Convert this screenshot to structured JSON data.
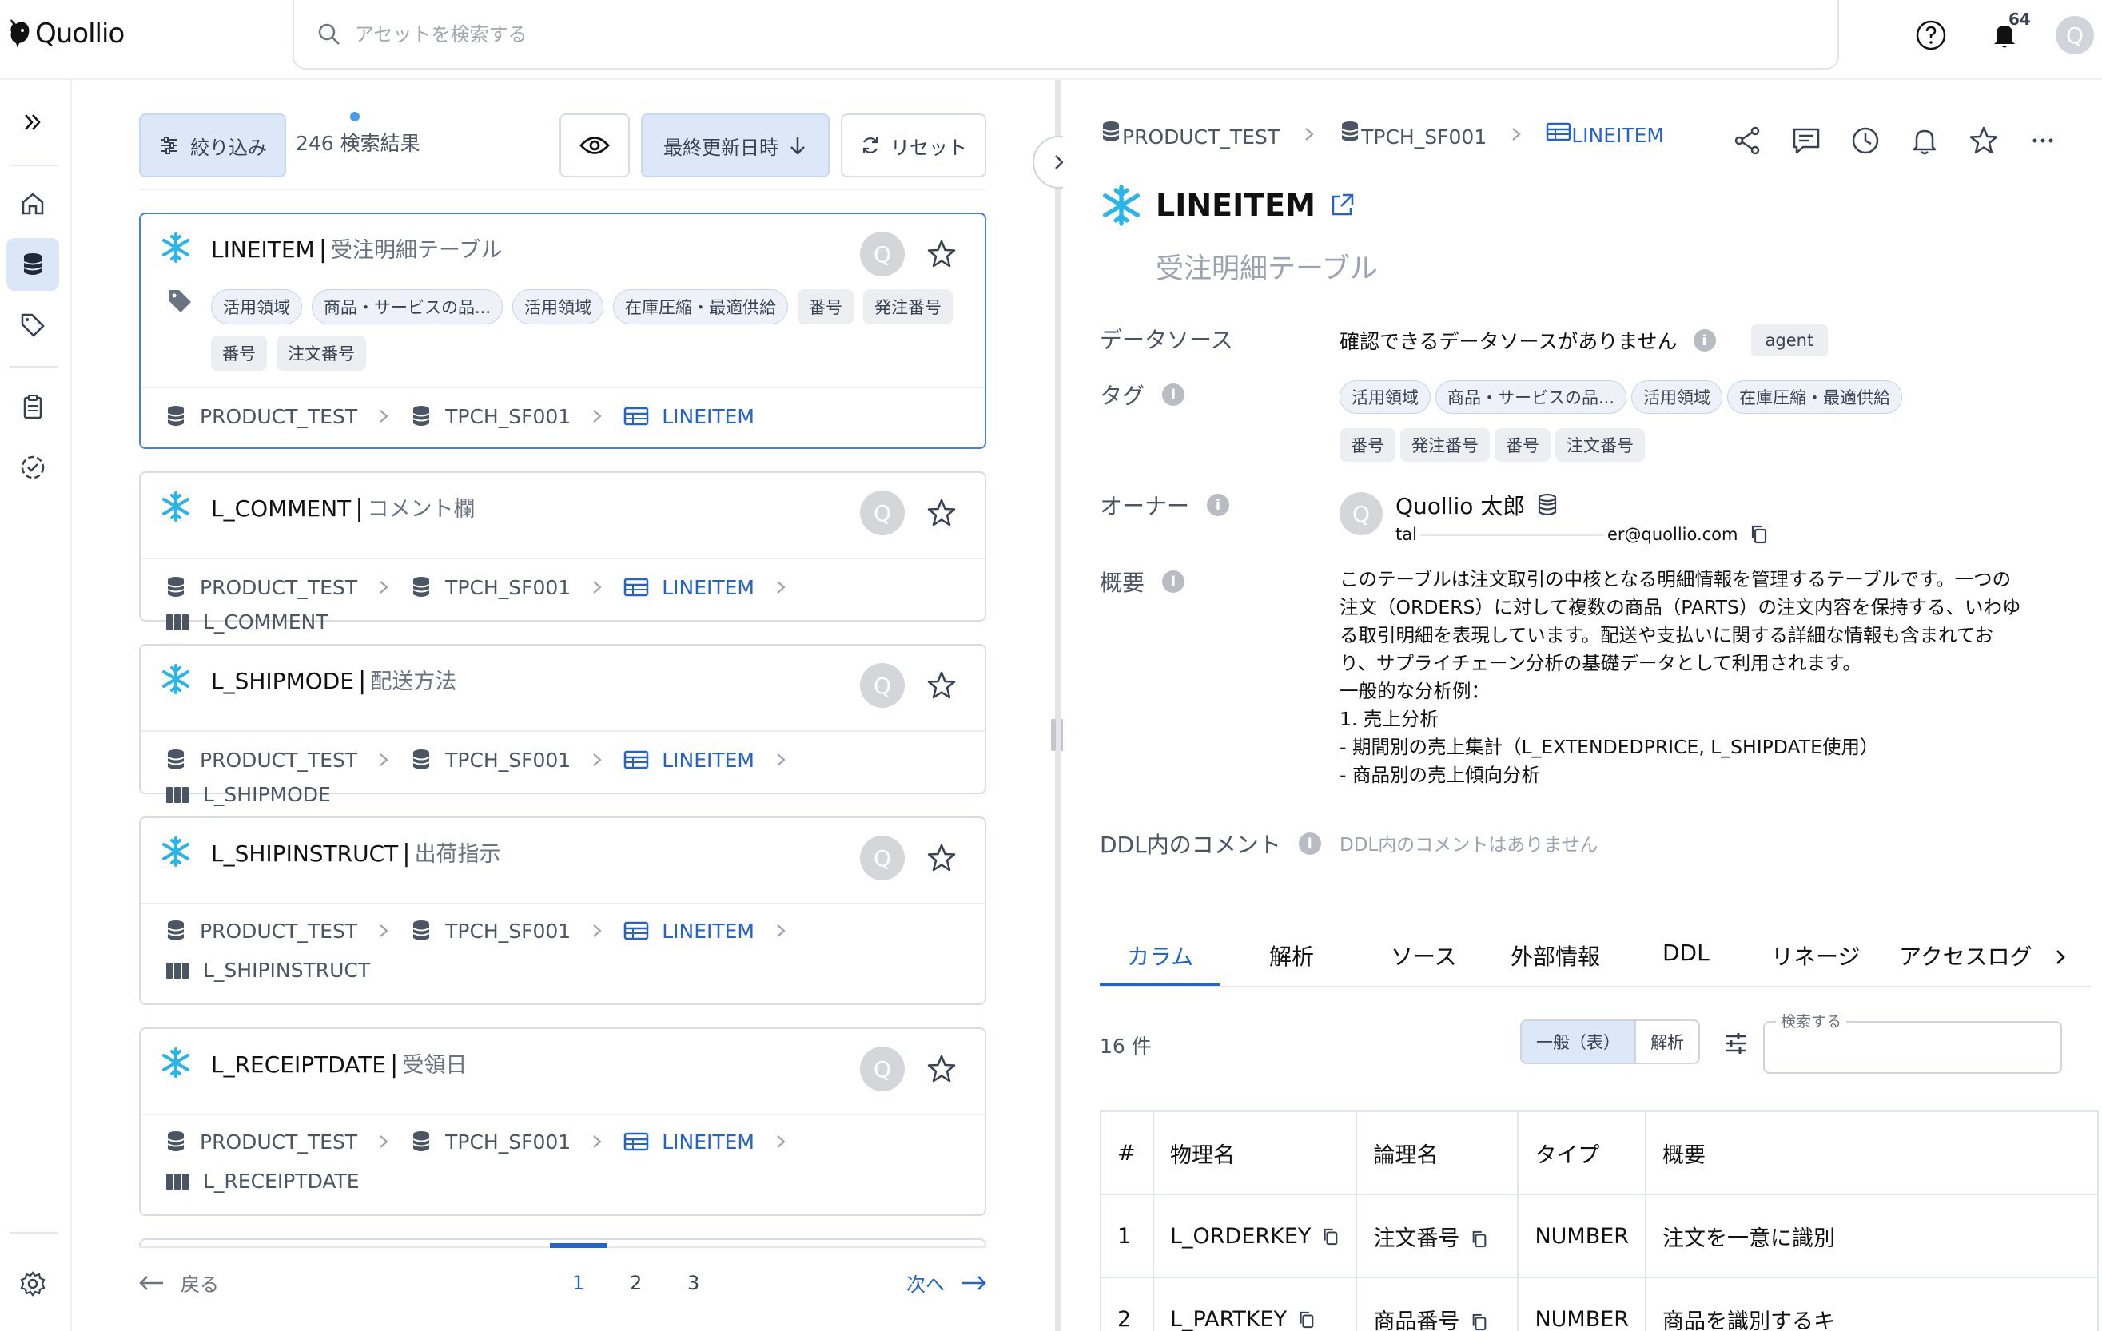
{
  "app": {
    "name": "Quollio"
  },
  "search": {
    "placeholder": "アセットを検索する"
  },
  "header": {
    "notification_count": "64",
    "user_initial": "Q"
  },
  "filters": {
    "filter_label": "絞り込み",
    "result_count": "246 検索結果",
    "sort_label": "最終更新日時",
    "reset_label": "リセット"
  },
  "results": [
    {
      "name": "LINEITEM",
      "logical": "受注明細テーブル",
      "avatar": "Q",
      "tags": [
        {
          "label": "活用領域",
          "style": "outline"
        },
        {
          "label": "商品・サービスの品...",
          "style": "outline"
        },
        {
          "label": "活用領域",
          "style": "outline"
        },
        {
          "label": "在庫圧縮・最適供給",
          "style": "outline"
        },
        {
          "label": "番号",
          "style": "plain"
        },
        {
          "label": "発注番号",
          "style": "plain"
        },
        {
          "label": "番号",
          "style": "plain"
        },
        {
          "label": "注文番号",
          "style": "plain"
        }
      ],
      "path": [
        "PRODUCT_TEST",
        "TPCH_SF001",
        "LINEITEM"
      ]
    },
    {
      "name": "L_COMMENT",
      "logical": "コメント欄",
      "avatar": "Q",
      "path": [
        "PRODUCT_TEST",
        "TPCH_SF001",
        "LINEITEM",
        "L_COMMENT"
      ]
    },
    {
      "name": "L_SHIPMODE",
      "logical": "配送方法",
      "avatar": "Q",
      "path": [
        "PRODUCT_TEST",
        "TPCH_SF001",
        "LINEITEM",
        "L_SHIPMODE"
      ]
    },
    {
      "name": "L_SHIPINSTRUCT",
      "logical": "出荷指示",
      "avatar": "Q",
      "path": [
        "PRODUCT_TEST",
        "TPCH_SF001",
        "LINEITEM",
        "L_SHIPINSTRUCT"
      ]
    },
    {
      "name": "L_RECEIPTDATE",
      "logical": "受領日",
      "avatar": "Q",
      "path": [
        "PRODUCT_TEST",
        "TPCH_SF001",
        "LINEITEM",
        "L_RECEIPTDATE"
      ]
    }
  ],
  "pagination": {
    "prev": "戻る",
    "next": "次へ",
    "pages": [
      "1",
      "2",
      "3"
    ],
    "current": "1"
  },
  "detail": {
    "breadcrumb": [
      "PRODUCT_TEST",
      "TPCH_SF001",
      "LINEITEM"
    ],
    "title": "LINEITEM",
    "subtitle": "受注明細テーブル",
    "fields": {
      "datasource_label": "データソース",
      "datasource_value": "確認できるデータソースがありません",
      "datasource_badge": "agent",
      "tag_label": "タグ",
      "owner_label": "オーナー",
      "summary_label": "概要",
      "ddl_label": "DDL内のコメント",
      "ddl_value": "DDL内のコメントはありません"
    },
    "tags": [
      {
        "label": "活用領域",
        "style": "outline"
      },
      {
        "label": "商品・サービスの品...",
        "style": "outline"
      },
      {
        "label": "活用領域",
        "style": "outline"
      },
      {
        "label": "在庫圧縮・最適供給",
        "style": "outline"
      },
      {
        "label": "番号",
        "style": "plain"
      },
      {
        "label": "発注番号",
        "style": "plain"
      },
      {
        "label": "番号",
        "style": "plain"
      },
      {
        "label": "注文番号",
        "style": "plain"
      }
    ],
    "owner": {
      "initial": "Q",
      "name": "Quollio 太郎",
      "email_start": "tal",
      "email_end": "er@quollio.com"
    },
    "summary": "このテーブルは注文取引の中核となる明細情報を管理するテーブルです。一つの注文（ORDERS）に対して複数の商品（PARTS）の注文内容を保持する、いわゆる取引明細を表現しています。配送や支払いに関する詳細な情報も含まれており、サプライチェーン分析の基礎データとして利用されます。\n一般的な分析例：\n1. 売上分析\n- 期間別の売上集計（L_EXTENDEDPRICE, L_SHIPDATE使用）\n- 商品別の売上傾向分析",
    "tabs": [
      "カラム",
      "解析",
      "ソース",
      "外部情報",
      "DDL",
      "リネージ",
      "アクセスログ"
    ],
    "active_tab": "カラム",
    "column_count": "16 件",
    "view_toggle": [
      "一般（表）",
      "解析"
    ],
    "column_search_label": "検索する",
    "table": {
      "headers": [
        "#",
        "物理名",
        "論理名",
        "タイプ",
        "概要"
      ],
      "rows": [
        [
          "1",
          "L_ORDERKEY",
          "注文番号",
          "NUMBER",
          "注文を一意に識別"
        ],
        [
          "2",
          "L_PARTKEY",
          "商品番号",
          "NUMBER",
          "商品を識別するキ"
        ]
      ]
    }
  },
  "colors": {
    "accent": "#2563c9",
    "selected_border": "#4a7fd4",
    "snowflake": "#29b5e8",
    "active_nav": "#dbe6f7"
  }
}
